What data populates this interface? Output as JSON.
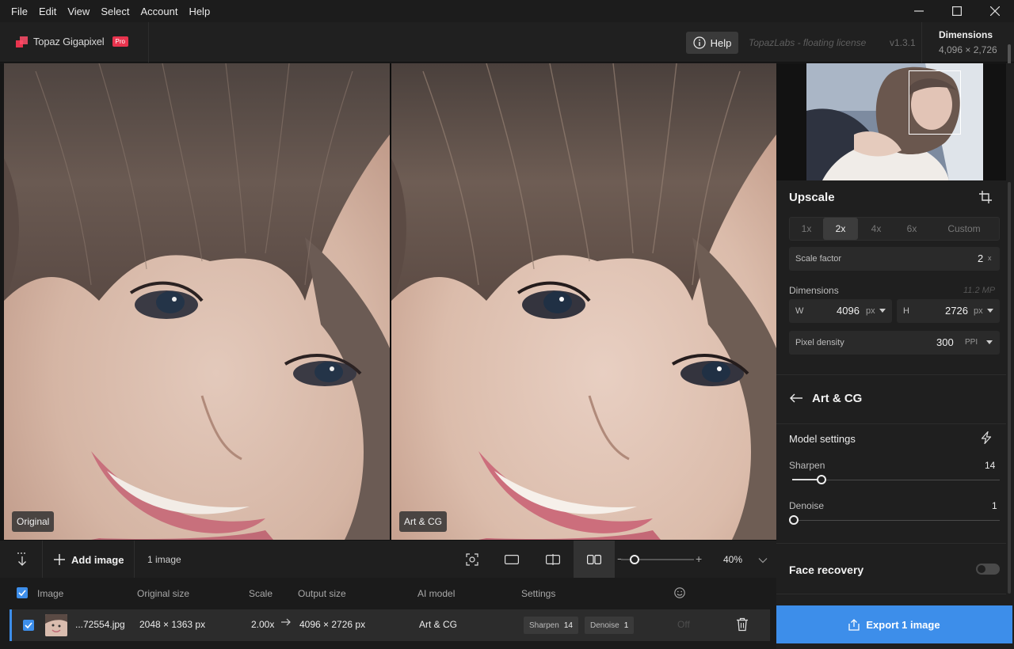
{
  "menu": [
    "File",
    "Edit",
    "View",
    "Select",
    "Account",
    "Help"
  ],
  "app": {
    "name": "Topaz Gigapixel",
    "badge": "Pro",
    "help_label": "Help",
    "license": "TopazLabs - floating license",
    "version": "v1.3.1",
    "dimensions_label": "Dimensions",
    "dimensions_value": "4,096 × 2,726"
  },
  "preview": {
    "left_label": "Original",
    "right_label": "Art & CG"
  },
  "toolbar": {
    "add_image_label": "Add image",
    "image_count": "1 image",
    "zoom_value": "40%",
    "zoom_fraction": 0.15
  },
  "filelist": {
    "columns": {
      "image": "Image",
      "original_size": "Original size",
      "scale": "Scale",
      "output_size": "Output size",
      "ai_model": "AI model",
      "settings": "Settings"
    },
    "row": {
      "filename": "...72554.jpg",
      "original_size": "2048 × 1363 px",
      "scale": "2.00x",
      "output_size": "4096 × 2726 px",
      "ai_model": "Art & CG",
      "sharpen_label": "Sharpen",
      "sharpen_value": "14",
      "denoise_label": "Denoise",
      "denoise_value": "1",
      "face_state": "Off"
    }
  },
  "upscale": {
    "title": "Upscale",
    "options": [
      "1x",
      "2x",
      "4x",
      "6x",
      "Custom"
    ],
    "selected": "2x",
    "scale_factor_label": "Scale factor",
    "scale_factor_value": "2",
    "scale_factor_unit": "x",
    "dimensions_label": "Dimensions",
    "megapixels": "11.2 MP",
    "width_label": "W",
    "width_value": "4096",
    "width_unit": "px",
    "height_label": "H",
    "height_value": "2726",
    "height_unit": "px",
    "density_label": "Pixel density",
    "density_value": "300",
    "density_unit": "PPI"
  },
  "model": {
    "name": "Art & CG",
    "settings_label": "Model settings",
    "sharpen_label": "Sharpen",
    "sharpen_value": "14",
    "sharpen_fraction": 0.14,
    "denoise_label": "Denoise",
    "denoise_value": "1",
    "denoise_fraction": 0.0
  },
  "face_recovery": {
    "label": "Face recovery",
    "enabled": false
  },
  "export": {
    "label": "Export 1 image"
  },
  "colors": {
    "accent": "#3d8eea",
    "brand": "#e8344e"
  }
}
